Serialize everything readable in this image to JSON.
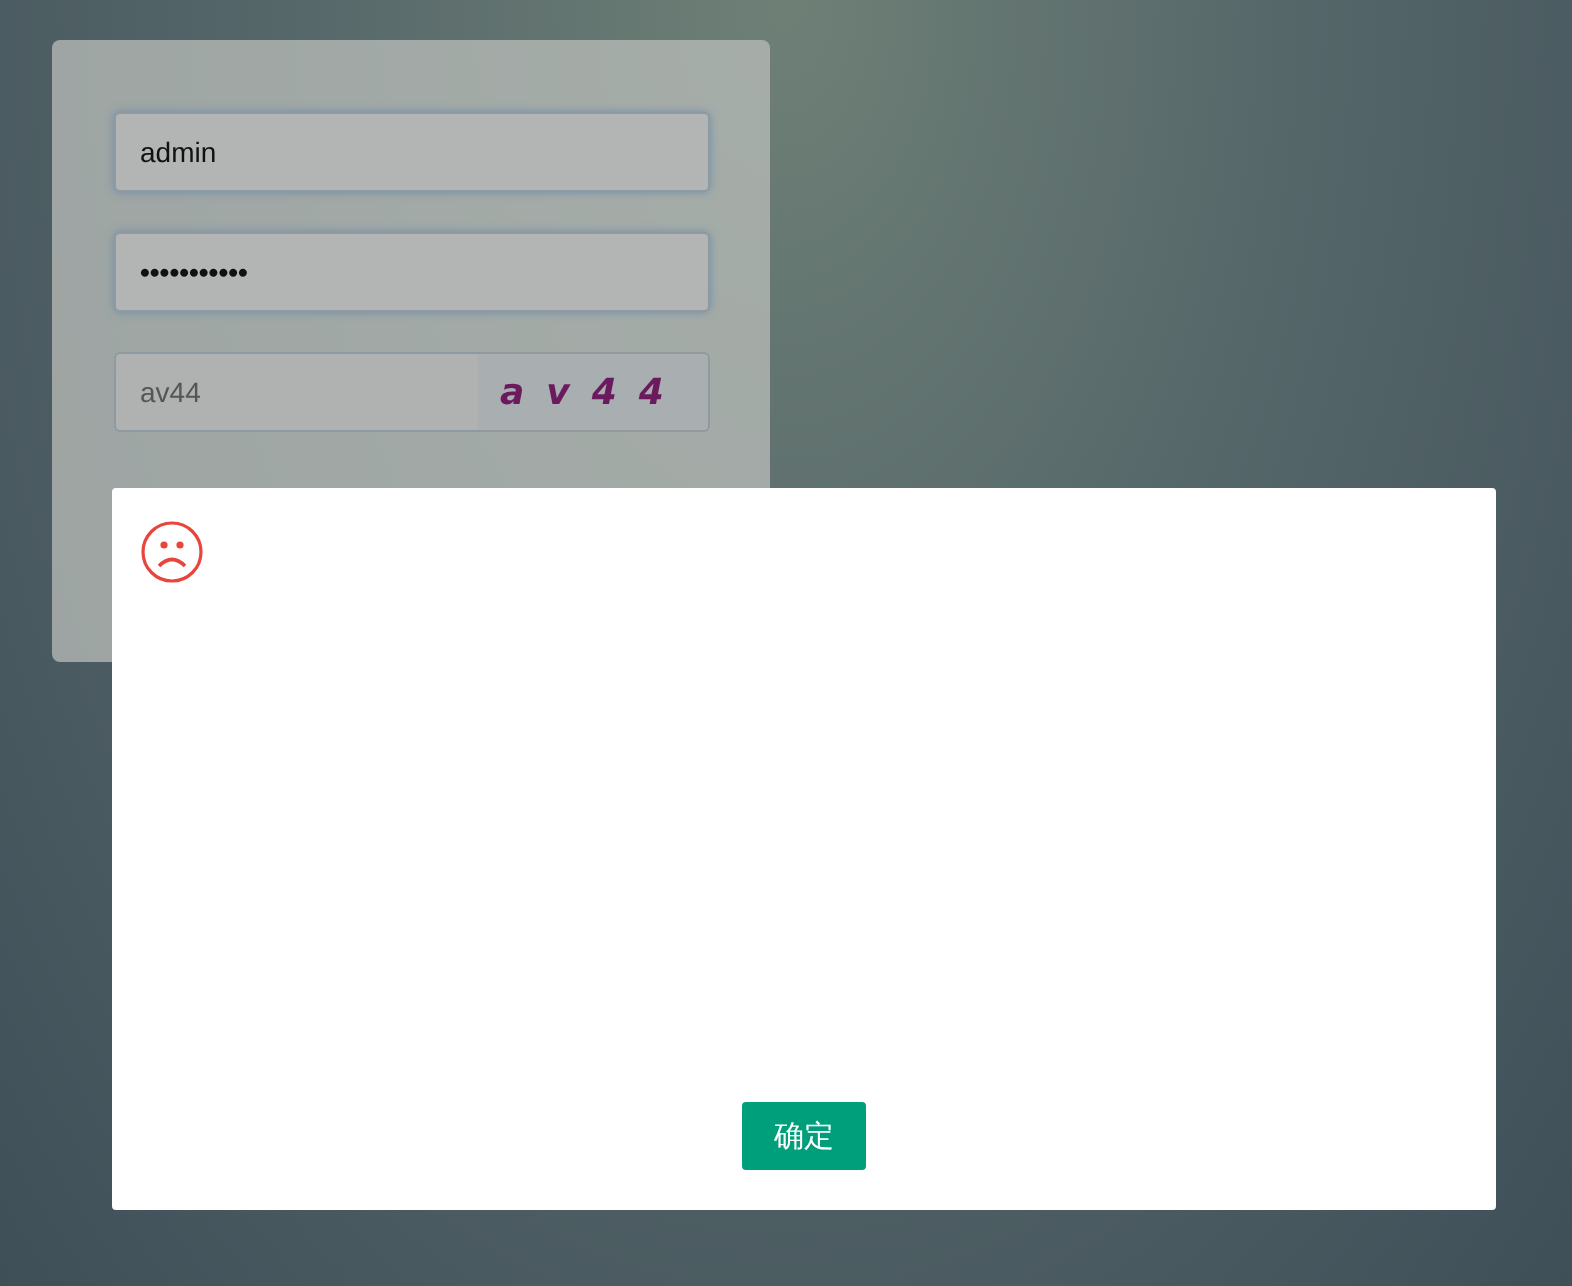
{
  "login": {
    "username": {
      "value": "admin"
    },
    "password": {
      "value": "•••••••••••"
    },
    "captcha": {
      "value": "av44",
      "image_text": "av44"
    }
  },
  "dialog": {
    "button": "确定"
  }
}
